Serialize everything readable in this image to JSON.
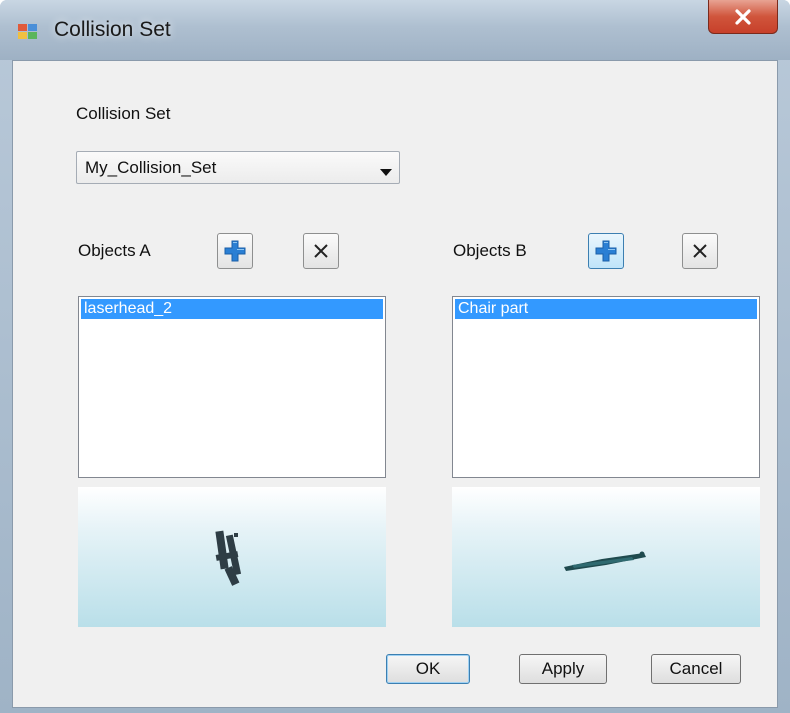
{
  "window": {
    "title": "Collision Set",
    "close_label": "x",
    "accent_color": "#3399ff"
  },
  "collision_set": {
    "label": "Collision Set",
    "selected": "My_Collision_Set"
  },
  "objects_a": {
    "label": "Objects A",
    "items": [
      "laserhead_2"
    ]
  },
  "objects_b": {
    "label": "Objects B",
    "items": [
      "Chair part"
    ]
  },
  "buttons": {
    "ok": "OK",
    "apply": "Apply",
    "cancel": "Cancel"
  },
  "icons": {
    "add": "plus-icon",
    "remove": "x-icon",
    "dropdown": "chevron-down-icon"
  }
}
